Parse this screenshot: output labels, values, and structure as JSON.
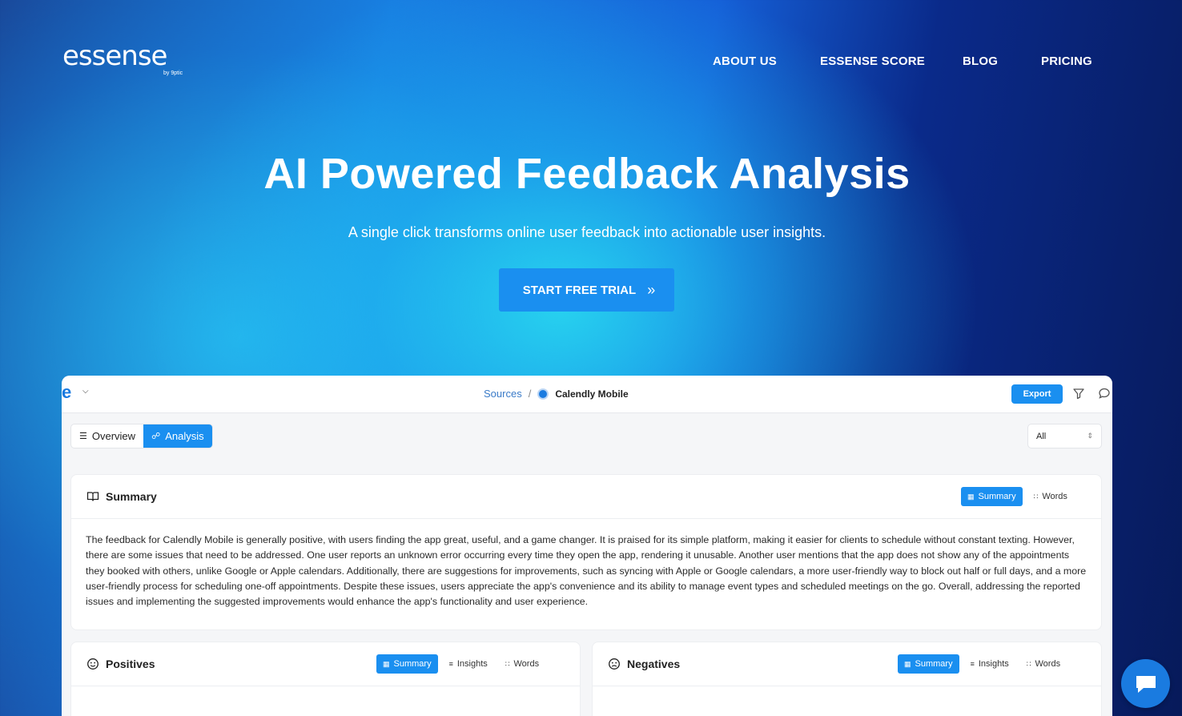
{
  "brand": {
    "name": "essense",
    "sub": "by 9ptic"
  },
  "nav": {
    "items": [
      "ABOUT US",
      "ESSENSE SCORE",
      "BLOG",
      "PRICING"
    ]
  },
  "hero": {
    "title": "AI Powered Feedback Analysis",
    "subtitle": "A single click transforms online user feedback into actionable user insights.",
    "cta_label": "START FREE TRIAL",
    "cta_arrow": "»"
  },
  "app": {
    "logo": "e",
    "breadcrumb": {
      "source": "Sources",
      "separator": "/",
      "current": "Calendly Mobile"
    },
    "export_label": "Export",
    "segments": [
      "Overview",
      "Analysis"
    ],
    "filter_value": "All",
    "summary": {
      "title": "Summary",
      "tabs": [
        "Summary",
        "Words"
      ],
      "text": "The feedback for Calendly Mobile is generally positive, with users finding the app great, useful, and a game changer. It is praised for its simple platform, making it easier for clients to schedule without constant texting. However, there are some issues that need to be addressed. One user reports an unknown error occurring every time they open the app, rendering it unusable. Another user mentions that the app does not show any of the appointments they booked with others, unlike Google or Apple calendars. Additionally, there are suggestions for improvements, such as syncing with Apple or Google calendars, a more user-friendly way to block out half or full days, and a more user-friendly process for scheduling one-off appointments. Despite these issues, users appreciate the app's convenience and its ability to manage event types and scheduled meetings on the go. Overall, addressing the reported issues and implementing the suggested improvements would enhance the app's functionality and user experience."
    },
    "positives": {
      "title": "Positives",
      "tabs": [
        "Summary",
        "Insights",
        "Words"
      ]
    },
    "negatives": {
      "title": "Negatives",
      "tabs": [
        "Summary",
        "Insights",
        "Words"
      ]
    }
  },
  "colors": {
    "accent": "#1a8ff0",
    "link": "#3a7bc8"
  },
  "icons": {
    "filter": "filter-icon",
    "comment": "comment-icon",
    "book": "book-icon",
    "smile": "smile-icon",
    "frown": "frown-icon",
    "chat": "chat-bubble-icon"
  }
}
